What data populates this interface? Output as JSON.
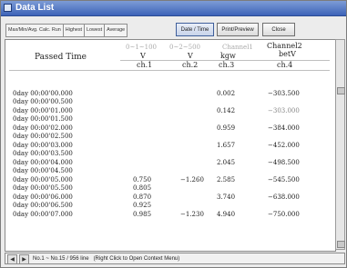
{
  "window": {
    "title": "Data List"
  },
  "toolbar": {
    "tabs": [
      "Max/Min/Avg. Calc. Run",
      "Highest",
      "Lowest",
      "Average"
    ],
    "date_time": "Date / Time",
    "print_preview": "Print/Preview",
    "close": "Close"
  },
  "header": {
    "passed_time": "Passed Time",
    "col1_top": "0~1~100",
    "col2_top": "0~2~500",
    "col3_top": "Channel1",
    "col4_top": "Channel2",
    "col1_unit": "V",
    "col2_unit": "V",
    "col3_unit": "kgw",
    "col4_unit": "betV",
    "col1_ch": "ch.1",
    "col2_ch": "ch.2",
    "col3_ch": "ch.3",
    "col4_ch": "ch.4"
  },
  "rows": [
    {
      "time": "0day 00:00'00.000",
      "c1": "",
      "c2": "",
      "c3": "0.002",
      "c4": "−303.500"
    },
    {
      "time": "0day 00:00'00.500",
      "c1": "",
      "c2": "",
      "c3": "",
      "c4": ""
    },
    {
      "time": "0day 00:00'01.000",
      "c1": "",
      "c2": "",
      "c3": "0.142",
      "c4": "−303.000"
    },
    {
      "time": "0day 00:00'01.500",
      "c1": "",
      "c2": "",
      "c3": "",
      "c4": ""
    },
    {
      "time": "0day 00:00'02.000",
      "c1": "",
      "c2": "",
      "c3": "0.959",
      "c4": "−384.000"
    },
    {
      "time": "0day 00:00'02.500",
      "c1": "",
      "c2": "",
      "c3": "",
      "c4": ""
    },
    {
      "time": "0day 00:00'03.000",
      "c1": "",
      "c2": "",
      "c3": "1.657",
      "c4": "−452.000"
    },
    {
      "time": "0day 00:00'03.500",
      "c1": "",
      "c2": "",
      "c3": "",
      "c4": ""
    },
    {
      "time": "0day 00:00'04.000",
      "c1": "",
      "c2": "",
      "c3": "2.045",
      "c4": "−498.500"
    },
    {
      "time": "0day 00:00'04.500",
      "c1": "",
      "c2": "",
      "c3": "",
      "c4": ""
    },
    {
      "time": "0day 00:00'05.000",
      "c1": "0.750",
      "c2": "−1.260",
      "c3": "2.585",
      "c4": "−545.500"
    },
    {
      "time": "0day 00:00'05.500",
      "c1": "0.805",
      "c2": "",
      "c3": "",
      "c4": ""
    },
    {
      "time": "0day 00:00'06.000",
      "c1": "0.870",
      "c2": "",
      "c3": "3.740",
      "c4": "−638.000"
    },
    {
      "time": "0day 00:00'06.500",
      "c1": "0.925",
      "c2": "",
      "c3": "",
      "c4": ""
    },
    {
      "time": "0day 00:00'07.000",
      "c1": "0.985",
      "c2": "−1.230",
      "c3": "4.940",
      "c4": "−750.000"
    }
  ],
  "status": {
    "text": "No.1 ~ No.15 / 956 line",
    "hint": "(Right Click to Open Context Menu)"
  }
}
